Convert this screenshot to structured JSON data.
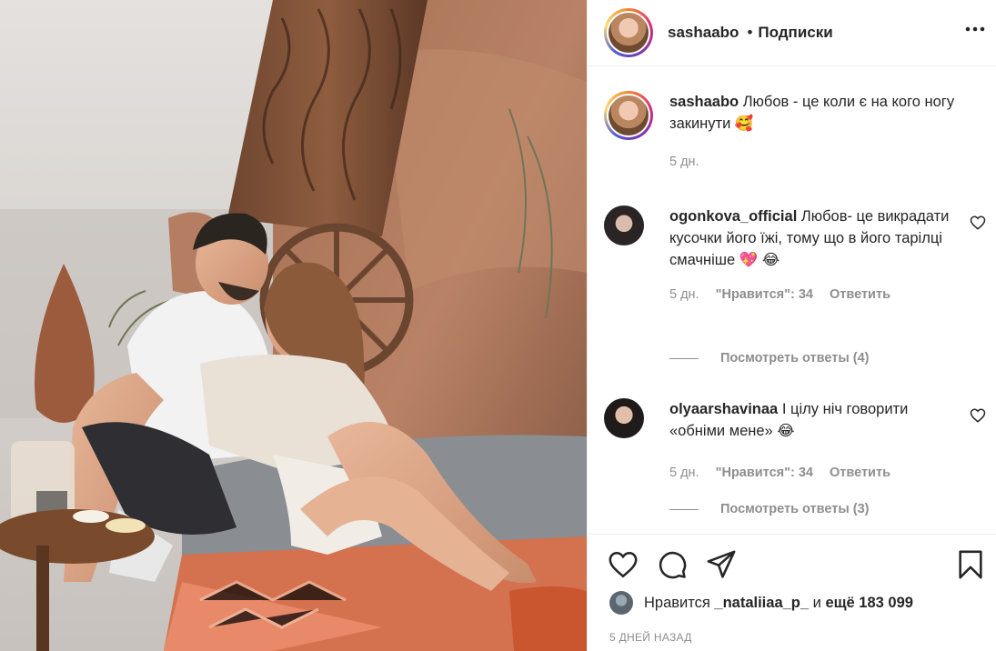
{
  "header": {
    "username": "sashaabo",
    "dot": "•",
    "follow_label": "Подписки",
    "more_icon": "more-horizontal-icon"
  },
  "caption": {
    "username": "sashaabo",
    "text": "Любов - це коли є на кого ногу закинути 🥰",
    "time": "5 дн."
  },
  "comments": [
    {
      "username": "ogonkova_official",
      "text": "Любов- це викрадати кусочки його їжі, тому що в його тарілці смачніше 💖 😂",
      "time": "5 дн.",
      "likes": "\"Нравится\": 34",
      "reply_label": "Ответить",
      "view_replies": "Посмотреть ответы (4)"
    },
    {
      "username": "olyaarshavinaa",
      "text": "І цілу ніч говорити «обніми мене» 😂",
      "time": "5 дн.",
      "likes": "\"Нравится\": 34",
      "reply_label": "Ответить",
      "view_replies": "Посмотреть ответы (3)"
    }
  ],
  "actions": {
    "like_icon": "heart-icon",
    "comment_icon": "comment-icon",
    "share_icon": "share-icon",
    "save_icon": "bookmark-icon"
  },
  "likes": {
    "prefix": "Нравится",
    "user": "_nataliiaa_p_",
    "connector": "и",
    "rest": "ещё 183 099"
  },
  "post_date": "5 ДНЕЙ НАЗАД",
  "colors": {
    "text": "#262626",
    "muted": "#8e8e8e",
    "border": "#efefef"
  }
}
